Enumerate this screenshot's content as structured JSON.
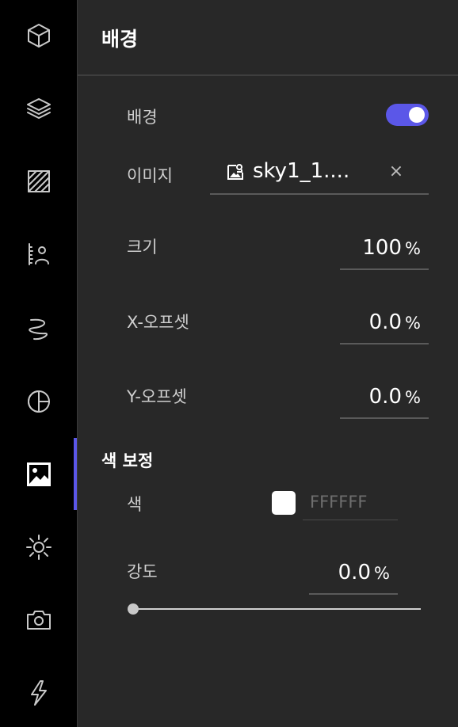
{
  "sidebar": {
    "items": [
      {
        "name": "cube-icon"
      },
      {
        "name": "layers-icon"
      },
      {
        "name": "hatch-pattern-icon"
      },
      {
        "name": "person-ruler-icon"
      },
      {
        "name": "squiggle-icon"
      },
      {
        "name": "globe-half-icon"
      },
      {
        "name": "image-icon",
        "active": true
      },
      {
        "name": "sun-icon"
      },
      {
        "name": "camera-icon"
      },
      {
        "name": "lightning-icon"
      }
    ]
  },
  "panel": {
    "title": "배경",
    "background": {
      "label": "배경",
      "toggle_on": true
    },
    "image": {
      "label": "이미지",
      "filename": "sky1_1....",
      "clear_symbol": "×"
    },
    "size": {
      "label": "크기",
      "value": "100",
      "unit": "%"
    },
    "x_offset": {
      "label": "X-오프셋",
      "value": "0.0",
      "unit": "%"
    },
    "y_offset": {
      "label": "Y-오프셋",
      "value": "0.0",
      "unit": "%"
    },
    "color_correction": {
      "section_title": "색 보정",
      "color": {
        "label": "색",
        "hex": "FFFFFF",
        "swatch": "#ffffff"
      },
      "intensity": {
        "label": "강도",
        "value": "0.0",
        "unit": "%",
        "slider_fraction": 0.0
      }
    }
  },
  "colors": {
    "accent": "#5b57e8",
    "panel_bg": "#282828",
    "sidebar_bg": "#000000"
  }
}
